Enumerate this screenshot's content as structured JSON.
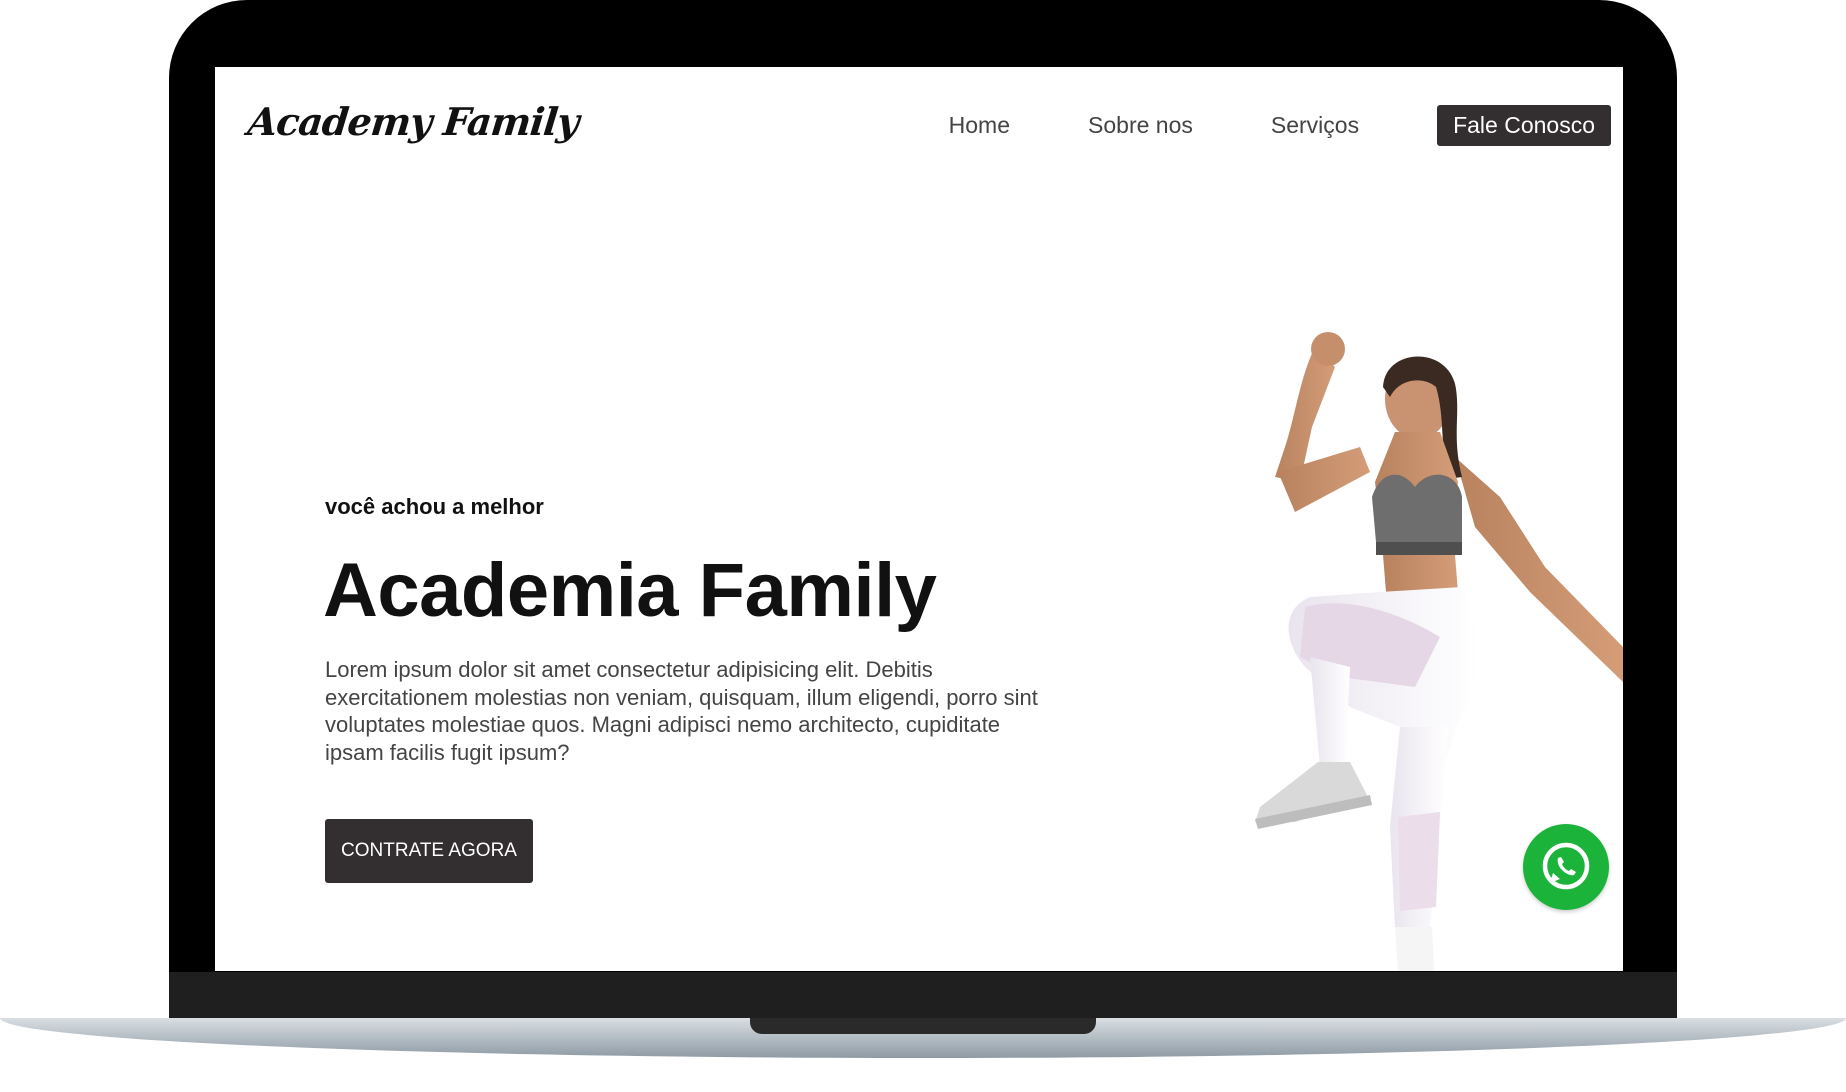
{
  "brand": {
    "logo_text": "Academy Family"
  },
  "nav": {
    "items": [
      {
        "label": "Home"
      },
      {
        "label": "Sobre nos"
      },
      {
        "label": "Serviços"
      }
    ],
    "cta_label": "Fale Conosco"
  },
  "hero": {
    "eyebrow": "você achou a melhor",
    "title": "Academia Family",
    "description": "Lorem ipsum dolor sit amet consectetur adipisicing elit. Debitis exercitationem molestias non veniam, quisquam, illum eligendi, porro sint voluptates molestiae quos. Magni adipisci nemo architecto, cupiditate ipsam facilis fugit ipsum?",
    "cta_label": "CONTRATE AGORA"
  },
  "icons": {
    "floating_button": "whatsapp-icon"
  },
  "colors": {
    "button_dark": "#332e30",
    "whatsapp_green": "#1cb33b",
    "heading": "#111111",
    "body_text": "#444444"
  }
}
